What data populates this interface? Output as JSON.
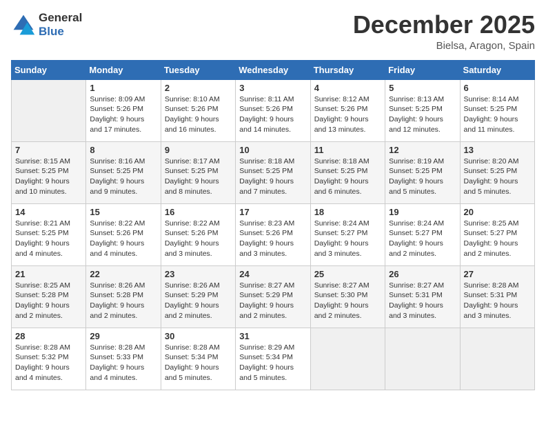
{
  "logo": {
    "line1": "General",
    "line2": "Blue"
  },
  "title": "December 2025",
  "location": "Bielsa, Aragon, Spain",
  "days_of_week": [
    "Sunday",
    "Monday",
    "Tuesday",
    "Wednesday",
    "Thursday",
    "Friday",
    "Saturday"
  ],
  "weeks": [
    [
      {
        "day": "",
        "sunrise": "",
        "sunset": "",
        "daylight": ""
      },
      {
        "day": "1",
        "sunrise": "Sunrise: 8:09 AM",
        "sunset": "Sunset: 5:26 PM",
        "daylight": "Daylight: 9 hours and 17 minutes."
      },
      {
        "day": "2",
        "sunrise": "Sunrise: 8:10 AM",
        "sunset": "Sunset: 5:26 PM",
        "daylight": "Daylight: 9 hours and 16 minutes."
      },
      {
        "day": "3",
        "sunrise": "Sunrise: 8:11 AM",
        "sunset": "Sunset: 5:26 PM",
        "daylight": "Daylight: 9 hours and 14 minutes."
      },
      {
        "day": "4",
        "sunrise": "Sunrise: 8:12 AM",
        "sunset": "Sunset: 5:26 PM",
        "daylight": "Daylight: 9 hours and 13 minutes."
      },
      {
        "day": "5",
        "sunrise": "Sunrise: 8:13 AM",
        "sunset": "Sunset: 5:25 PM",
        "daylight": "Daylight: 9 hours and 12 minutes."
      },
      {
        "day": "6",
        "sunrise": "Sunrise: 8:14 AM",
        "sunset": "Sunset: 5:25 PM",
        "daylight": "Daylight: 9 hours and 11 minutes."
      }
    ],
    [
      {
        "day": "7",
        "sunrise": "Sunrise: 8:15 AM",
        "sunset": "Sunset: 5:25 PM",
        "daylight": "Daylight: 9 hours and 10 minutes."
      },
      {
        "day": "8",
        "sunrise": "Sunrise: 8:16 AM",
        "sunset": "Sunset: 5:25 PM",
        "daylight": "Daylight: 9 hours and 9 minutes."
      },
      {
        "day": "9",
        "sunrise": "Sunrise: 8:17 AM",
        "sunset": "Sunset: 5:25 PM",
        "daylight": "Daylight: 9 hours and 8 minutes."
      },
      {
        "day": "10",
        "sunrise": "Sunrise: 8:18 AM",
        "sunset": "Sunset: 5:25 PM",
        "daylight": "Daylight: 9 hours and 7 minutes."
      },
      {
        "day": "11",
        "sunrise": "Sunrise: 8:18 AM",
        "sunset": "Sunset: 5:25 PM",
        "daylight": "Daylight: 9 hours and 6 minutes."
      },
      {
        "day": "12",
        "sunrise": "Sunrise: 8:19 AM",
        "sunset": "Sunset: 5:25 PM",
        "daylight": "Daylight: 9 hours and 5 minutes."
      },
      {
        "day": "13",
        "sunrise": "Sunrise: 8:20 AM",
        "sunset": "Sunset: 5:25 PM",
        "daylight": "Daylight: 9 hours and 5 minutes."
      }
    ],
    [
      {
        "day": "14",
        "sunrise": "Sunrise: 8:21 AM",
        "sunset": "Sunset: 5:25 PM",
        "daylight": "Daylight: 9 hours and 4 minutes."
      },
      {
        "day": "15",
        "sunrise": "Sunrise: 8:22 AM",
        "sunset": "Sunset: 5:26 PM",
        "daylight": "Daylight: 9 hours and 4 minutes."
      },
      {
        "day": "16",
        "sunrise": "Sunrise: 8:22 AM",
        "sunset": "Sunset: 5:26 PM",
        "daylight": "Daylight: 9 hours and 3 minutes."
      },
      {
        "day": "17",
        "sunrise": "Sunrise: 8:23 AM",
        "sunset": "Sunset: 5:26 PM",
        "daylight": "Daylight: 9 hours and 3 minutes."
      },
      {
        "day": "18",
        "sunrise": "Sunrise: 8:24 AM",
        "sunset": "Sunset: 5:27 PM",
        "daylight": "Daylight: 9 hours and 3 minutes."
      },
      {
        "day": "19",
        "sunrise": "Sunrise: 8:24 AM",
        "sunset": "Sunset: 5:27 PM",
        "daylight": "Daylight: 9 hours and 2 minutes."
      },
      {
        "day": "20",
        "sunrise": "Sunrise: 8:25 AM",
        "sunset": "Sunset: 5:27 PM",
        "daylight": "Daylight: 9 hours and 2 minutes."
      }
    ],
    [
      {
        "day": "21",
        "sunrise": "Sunrise: 8:25 AM",
        "sunset": "Sunset: 5:28 PM",
        "daylight": "Daylight: 9 hours and 2 minutes."
      },
      {
        "day": "22",
        "sunrise": "Sunrise: 8:26 AM",
        "sunset": "Sunset: 5:28 PM",
        "daylight": "Daylight: 9 hours and 2 minutes."
      },
      {
        "day": "23",
        "sunrise": "Sunrise: 8:26 AM",
        "sunset": "Sunset: 5:29 PM",
        "daylight": "Daylight: 9 hours and 2 minutes."
      },
      {
        "day": "24",
        "sunrise": "Sunrise: 8:27 AM",
        "sunset": "Sunset: 5:29 PM",
        "daylight": "Daylight: 9 hours and 2 minutes."
      },
      {
        "day": "25",
        "sunrise": "Sunrise: 8:27 AM",
        "sunset": "Sunset: 5:30 PM",
        "daylight": "Daylight: 9 hours and 2 minutes."
      },
      {
        "day": "26",
        "sunrise": "Sunrise: 8:27 AM",
        "sunset": "Sunset: 5:31 PM",
        "daylight": "Daylight: 9 hours and 3 minutes."
      },
      {
        "day": "27",
        "sunrise": "Sunrise: 8:28 AM",
        "sunset": "Sunset: 5:31 PM",
        "daylight": "Daylight: 9 hours and 3 minutes."
      }
    ],
    [
      {
        "day": "28",
        "sunrise": "Sunrise: 8:28 AM",
        "sunset": "Sunset: 5:32 PM",
        "daylight": "Daylight: 9 hours and 4 minutes."
      },
      {
        "day": "29",
        "sunrise": "Sunrise: 8:28 AM",
        "sunset": "Sunset: 5:33 PM",
        "daylight": "Daylight: 9 hours and 4 minutes."
      },
      {
        "day": "30",
        "sunrise": "Sunrise: 8:28 AM",
        "sunset": "Sunset: 5:34 PM",
        "daylight": "Daylight: 9 hours and 5 minutes."
      },
      {
        "day": "31",
        "sunrise": "Sunrise: 8:29 AM",
        "sunset": "Sunset: 5:34 PM",
        "daylight": "Daylight: 9 hours and 5 minutes."
      },
      {
        "day": "",
        "sunrise": "",
        "sunset": "",
        "daylight": ""
      },
      {
        "day": "",
        "sunrise": "",
        "sunset": "",
        "daylight": ""
      },
      {
        "day": "",
        "sunrise": "",
        "sunset": "",
        "daylight": ""
      }
    ]
  ]
}
